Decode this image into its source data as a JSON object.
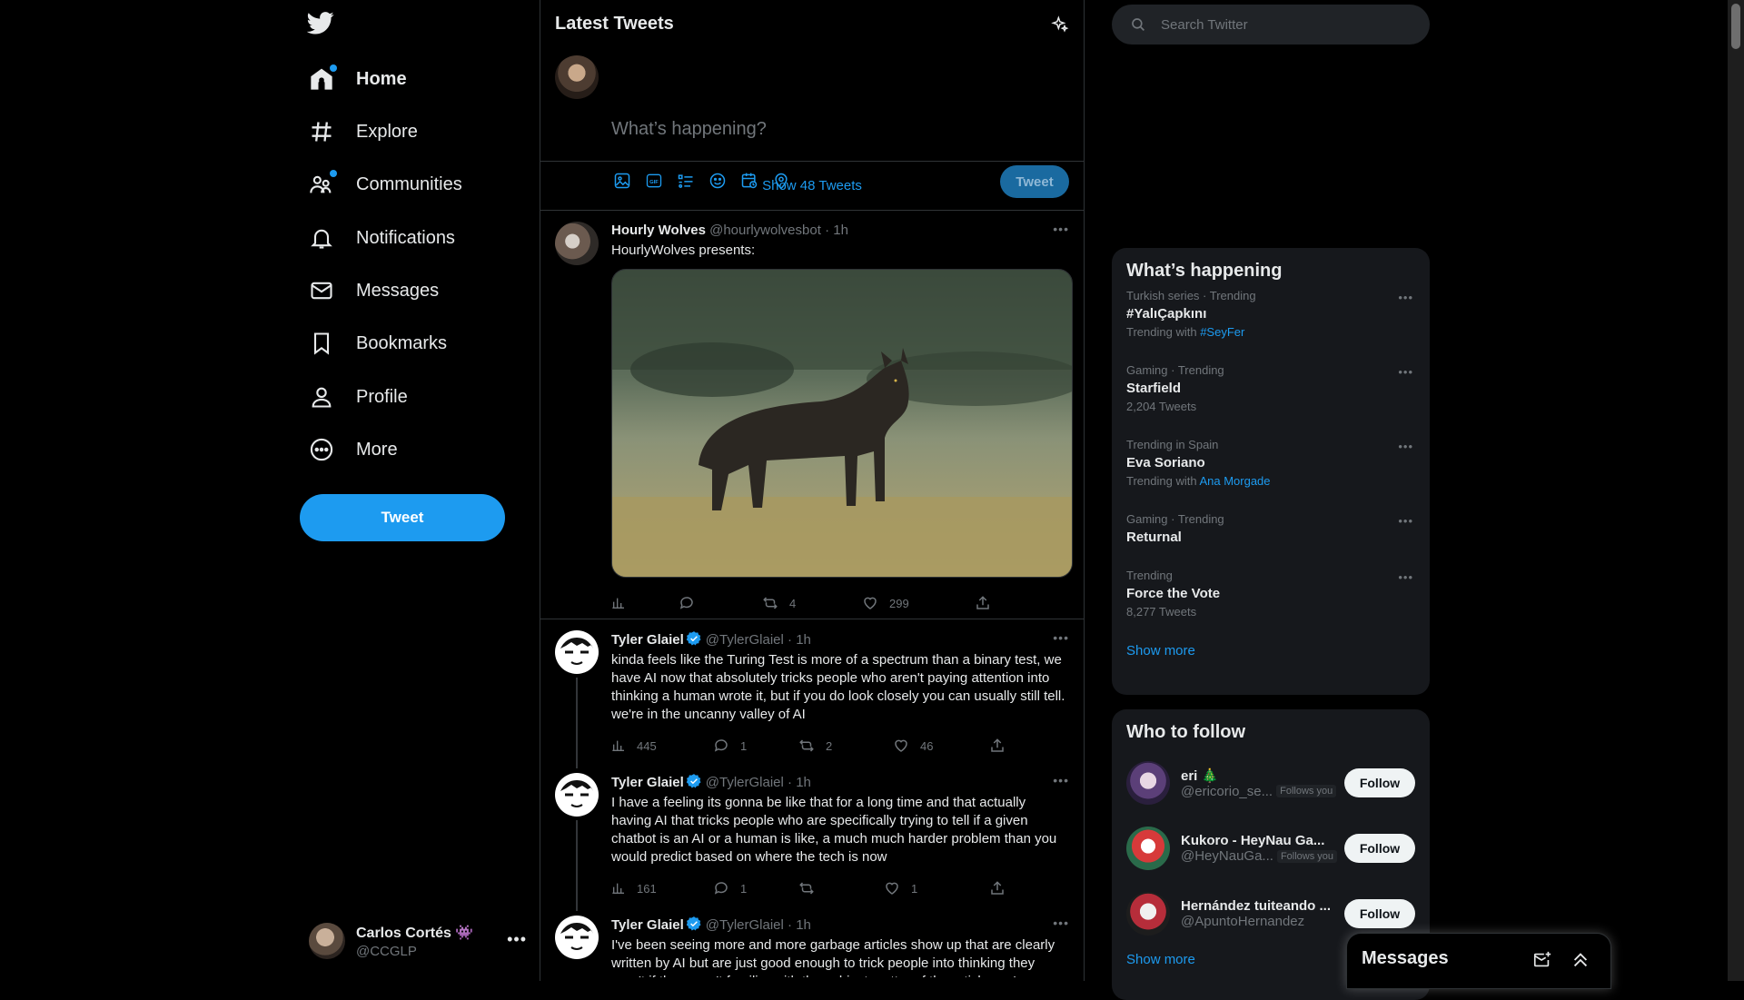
{
  "colors": {
    "accent": "#1d9bf0",
    "background": "#000000",
    "panel": "#16181c",
    "border": "#2f3336",
    "muted": "#71767b"
  },
  "nav": {
    "logo_icon": "twitter-bird-icon",
    "items": [
      {
        "label": "Home",
        "icon": "home-icon",
        "active": true,
        "dot": true
      },
      {
        "label": "Explore",
        "icon": "hashtag-icon"
      },
      {
        "label": "Communities",
        "icon": "communities-icon",
        "dot": true
      },
      {
        "label": "Notifications",
        "icon": "bell-icon"
      },
      {
        "label": "Messages",
        "icon": "envelope-icon"
      },
      {
        "label": "Bookmarks",
        "icon": "bookmark-icon"
      },
      {
        "label": "Profile",
        "icon": "person-icon"
      },
      {
        "label": "More",
        "icon": "more-circle-icon"
      }
    ],
    "tweet_button": "Tweet"
  },
  "account": {
    "name": "Carlos Cortés",
    "emoji": "👾",
    "handle": "@CCGLP"
  },
  "feed": {
    "title": "Latest Tweets",
    "composer": {
      "placeholder": "What’s happening?",
      "button": "Tweet"
    },
    "show_new": "Show 48 Tweets",
    "tweets": [
      {
        "name": "Hourly Wolves",
        "handle": "@hourlywolvesbot",
        "time": "1h",
        "text": "HourlyWolves presents:",
        "views": "",
        "replies": "",
        "retweets": "4",
        "likes": "299"
      },
      {
        "name": "Tyler Glaiel",
        "handle": "@TylerGlaiel",
        "time": "1h",
        "verified": true,
        "text": "kinda feels like the Turing Test is more of a spectrum than a binary test, we have AI now that absolutely tricks people who aren't paying attention into thinking a human wrote it, but if you do look closely you can usually still tell. we're in the uncanny valley of AI",
        "views": "445",
        "replies": "1",
        "retweets": "2",
        "likes": "46"
      },
      {
        "name": "Tyler Glaiel",
        "handle": "@TylerGlaiel",
        "time": "1h",
        "verified": true,
        "text": "I have a feeling its gonna be like that for a long time and that actually having AI that tricks people who are specifically trying to tell if a given chatbot is an AI or a human is like, a much much harder problem than you would predict based on where the tech is now",
        "views": "161",
        "replies": "1",
        "retweets": "",
        "likes": "1"
      },
      {
        "name": "Tyler Glaiel",
        "handle": "@TylerGlaiel",
        "time": "1h",
        "verified": true,
        "text": "I've been seeing more and more garbage articles show up that are clearly written by AI but are just good enough to trick people into thinking they aren't if they aren't familiar with the subject matter of the article, we're"
      }
    ]
  },
  "search": {
    "placeholder": "Search Twitter"
  },
  "trends": {
    "title": "What’s happening",
    "items": [
      {
        "category": "Turkish series · Trending",
        "name": "#YalıÇapkını",
        "sub_prefix": "Trending with",
        "sub_link": "#SeyFer"
      },
      {
        "category": "Gaming · Trending",
        "name": "Starfield",
        "sub": "2,204 Tweets"
      },
      {
        "category": "Trending in Spain",
        "name": "Eva Soriano",
        "sub_prefix": "Trending with",
        "sub_link": "Ana Morgade"
      },
      {
        "category": "Gaming · Trending",
        "name": "Returnal"
      },
      {
        "category": "Trending",
        "name": "Force the Vote",
        "sub": "8,277 Tweets"
      }
    ],
    "show_more": "Show more"
  },
  "who_to_follow": {
    "title": "Who to follow",
    "users": [
      {
        "name": "eri 🎄",
        "handle": "@ericorio_se...",
        "follows_you": "Follows you",
        "button": "Follow"
      },
      {
        "name": "Kukoro - HeyNau Ga...",
        "handle": "@HeyNauGa...",
        "follows_you": "Follows you",
        "button": "Follow"
      },
      {
        "name": "Hernández tuiteando ...",
        "handle": "@ApuntoHernandez",
        "button": "Follow"
      }
    ],
    "show_more": "Show more"
  },
  "messages_drawer": {
    "title": "Messages"
  }
}
